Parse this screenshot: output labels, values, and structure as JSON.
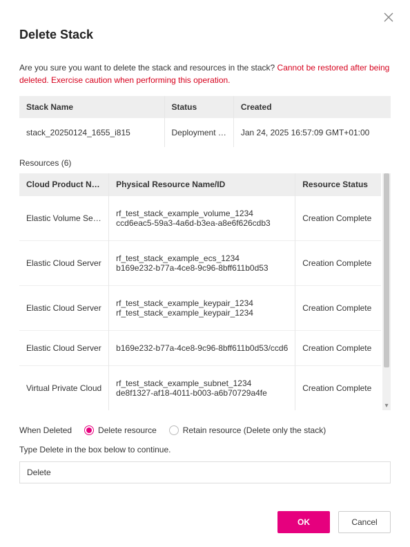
{
  "dialog": {
    "title": "Delete Stack",
    "confirm_question": "Are you sure you want to delete the stack and resources in the stack? ",
    "warning": "Cannot be restored after being deleted. Exercise caution when performing this operation."
  },
  "stack_table": {
    "headers": {
      "name": "Stack Name",
      "status": "Status",
      "created": "Created"
    },
    "row": {
      "name": "stack_20250124_1655_i815",
      "status": "Deployment …",
      "created": "Jan 24, 2025 16:57:09 GMT+01:00"
    }
  },
  "resources": {
    "heading_prefix": "Resources",
    "count": 6,
    "headers": {
      "product": "Cloud Product N…",
      "physical": "Physical Resource Name/ID",
      "status": "Resource Status"
    },
    "rows": [
      {
        "type": "Elastic Volume Se…",
        "line1": "rf_test_stack_example_volume_1234",
        "line2": "ccd6eac5-59a3-4a6d-b3ea-a8e6f626cdb3",
        "status": "Creation Complete"
      },
      {
        "type": "Elastic Cloud Server",
        "line1": "rf_test_stack_example_ecs_1234",
        "line2": "b169e232-b77a-4ce8-9c96-8bff611b0d53",
        "status": "Creation Complete"
      },
      {
        "type": "Elastic Cloud Server",
        "line1": "rf_test_stack_example_keypair_1234",
        "line2": "rf_test_stack_example_keypair_1234",
        "status": "Creation Complete"
      },
      {
        "type": "Elastic Cloud Server",
        "line1": "b169e232-b77a-4ce8-9c96-8bff611b0d53/ccd6",
        "line2": "",
        "status": "Creation Complete"
      },
      {
        "type": "Virtual Private Cloud",
        "line1": "rf_test_stack_example_subnet_1234",
        "line2": "de8f1327-af18-4011-b003-a6b70729a4fe",
        "status": "Creation Complete"
      }
    ]
  },
  "when_deleted": {
    "label": "When Deleted",
    "options": {
      "delete": "Delete resource",
      "retain": "Retain resource (Delete only the stack)"
    },
    "selected": "delete"
  },
  "confirm_input": {
    "instruction": "Type Delete in the box below to continue.",
    "value": "Delete"
  },
  "footer": {
    "ok": "OK",
    "cancel": "Cancel"
  },
  "colors": {
    "accent": "#e6007e",
    "danger": "#d6001c"
  }
}
